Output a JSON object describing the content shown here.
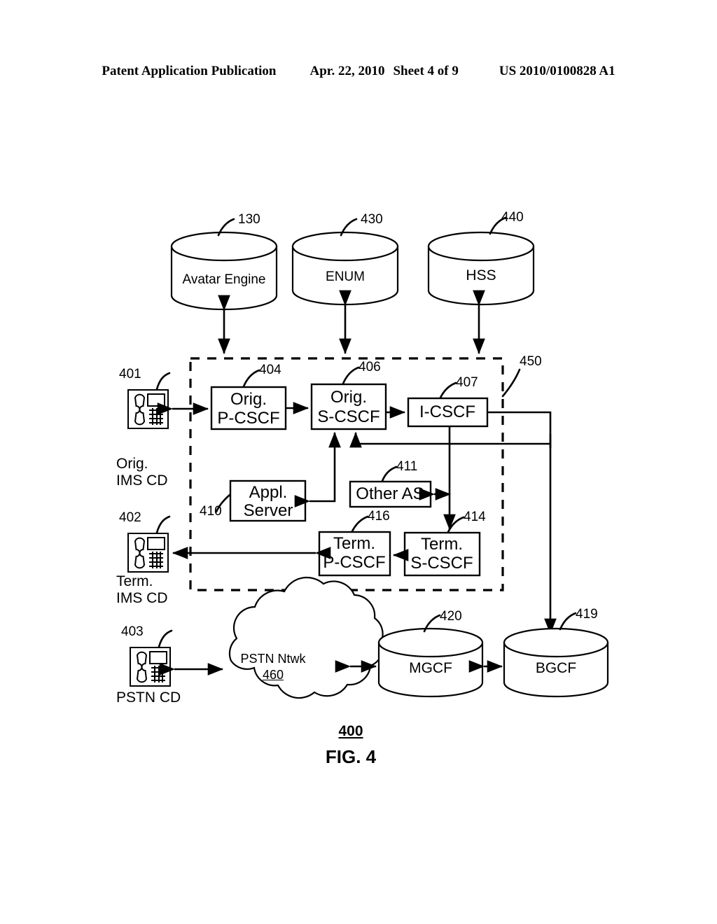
{
  "header": {
    "publication": "Patent Application Publication",
    "date": "Apr. 22, 2010",
    "sheet": "Sheet 4 of 9",
    "patent_number": "US 2010/0100828 A1"
  },
  "figure": {
    "number_label": "400",
    "caption": "FIG. 4"
  },
  "databases": [
    {
      "label": "Avatar Engine",
      "ref": "130"
    },
    {
      "label": "ENUM",
      "ref": "430"
    },
    {
      "label": "HSS",
      "ref": "440"
    }
  ],
  "network_boundary": {
    "ref": "450"
  },
  "nodes": {
    "orig_p_cscf": {
      "line1": "Orig.",
      "line2": "P-CSCF",
      "ref": "404"
    },
    "orig_s_cscf": {
      "line1": "Orig.",
      "line2": "S-CSCF",
      "ref": "406"
    },
    "i_cscf": {
      "line1": "I-CSCF",
      "line2": "",
      "ref": "407"
    },
    "appl_server": {
      "line1": "Appl.",
      "line2": "Server",
      "ref": "410"
    },
    "other_as": {
      "line1": "Other AS",
      "line2": "",
      "ref": "411"
    },
    "term_p_cscf": {
      "line1": "Term.",
      "line2": "P-CSCF",
      "ref": "416"
    },
    "term_s_cscf": {
      "line1": "Term.",
      "line2": "S-CSCF",
      "ref": "414"
    }
  },
  "endpoints": {
    "orig_ims_cd": {
      "ref": "401",
      "label_line1": "Orig.",
      "label_line2": "IMS CD"
    },
    "term_ims_cd": {
      "ref": "402",
      "label_line1": "Term.",
      "label_line2": "IMS CD"
    },
    "pstn_cd": {
      "ref": "403",
      "label_line1": "PSTN CD",
      "label_line2": ""
    }
  },
  "pstn_cloud": {
    "label": "PSTN Ntwk",
    "ref": "460"
  },
  "gateways": [
    {
      "label": "MGCF",
      "ref": "420"
    },
    {
      "label": "BGCF",
      "ref": "419"
    }
  ]
}
